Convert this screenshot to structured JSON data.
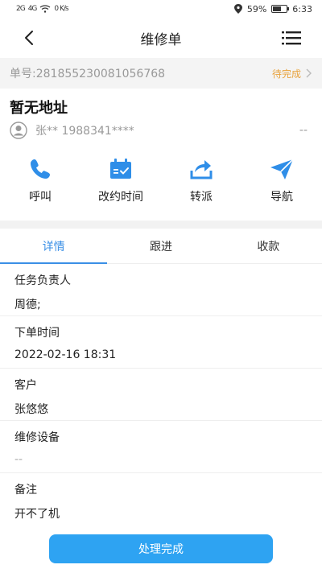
{
  "status_bar": {
    "signal_left": "2G",
    "signal_right": "4G",
    "speed": "0 K/s",
    "battery_percent": "59%",
    "battery_level": 0.59,
    "time": "6:33"
  },
  "nav": {
    "title": "维修单"
  },
  "order": {
    "number": "单号:281855230081056768",
    "status": "待完成"
  },
  "address": "暂无地址",
  "contact": {
    "name_phone": "张** 1988341****",
    "right": "--"
  },
  "actions": [
    {
      "label": "呼叫",
      "icon": "phone-icon"
    },
    {
      "label": "改约时间",
      "icon": "calendar-icon"
    },
    {
      "label": "转派",
      "icon": "forward-icon"
    },
    {
      "label": "导航",
      "icon": "navigation-icon"
    }
  ],
  "tabs": [
    {
      "label": "详情",
      "active": true
    },
    {
      "label": "跟进",
      "active": false
    },
    {
      "label": "收款",
      "active": false
    }
  ],
  "details": [
    {
      "label": "任务负责人",
      "value": "周德;"
    },
    {
      "label": "下单时间",
      "value": "2022-02-16 18:31"
    },
    {
      "label": "客户",
      "value": "张悠悠"
    },
    {
      "label": "维修设备",
      "value": "--"
    },
    {
      "label": "备注",
      "value": "开不了机"
    }
  ],
  "bottom_button": {
    "label": "处理完成"
  },
  "colors": {
    "accent": "#3a8fe6",
    "button": "#2ea3f2",
    "status_orange": "#e8a23c"
  }
}
